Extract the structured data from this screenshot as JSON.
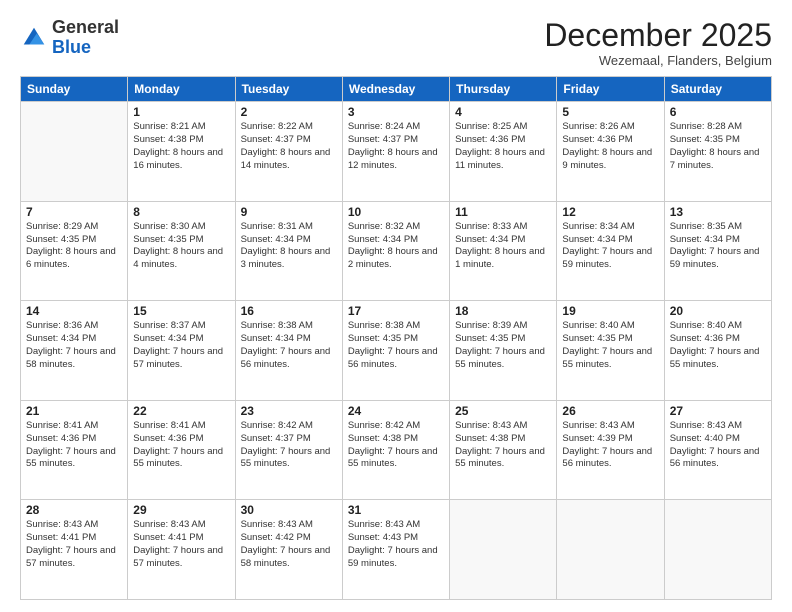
{
  "header": {
    "logo_general": "General",
    "logo_blue": "Blue",
    "month_title": "December 2025",
    "location": "Wezemaal, Flanders, Belgium"
  },
  "weekdays": [
    "Sunday",
    "Monday",
    "Tuesday",
    "Wednesday",
    "Thursday",
    "Friday",
    "Saturday"
  ],
  "weeks": [
    [
      {
        "day": "",
        "sunrise": "",
        "sunset": "",
        "daylight": ""
      },
      {
        "day": "1",
        "sunrise": "Sunrise: 8:21 AM",
        "sunset": "Sunset: 4:38 PM",
        "daylight": "Daylight: 8 hours and 16 minutes."
      },
      {
        "day": "2",
        "sunrise": "Sunrise: 8:22 AM",
        "sunset": "Sunset: 4:37 PM",
        "daylight": "Daylight: 8 hours and 14 minutes."
      },
      {
        "day": "3",
        "sunrise": "Sunrise: 8:24 AM",
        "sunset": "Sunset: 4:37 PM",
        "daylight": "Daylight: 8 hours and 12 minutes."
      },
      {
        "day": "4",
        "sunrise": "Sunrise: 8:25 AM",
        "sunset": "Sunset: 4:36 PM",
        "daylight": "Daylight: 8 hours and 11 minutes."
      },
      {
        "day": "5",
        "sunrise": "Sunrise: 8:26 AM",
        "sunset": "Sunset: 4:36 PM",
        "daylight": "Daylight: 8 hours and 9 minutes."
      },
      {
        "day": "6",
        "sunrise": "Sunrise: 8:28 AM",
        "sunset": "Sunset: 4:35 PM",
        "daylight": "Daylight: 8 hours and 7 minutes."
      }
    ],
    [
      {
        "day": "7",
        "sunrise": "Sunrise: 8:29 AM",
        "sunset": "Sunset: 4:35 PM",
        "daylight": "Daylight: 8 hours and 6 minutes."
      },
      {
        "day": "8",
        "sunrise": "Sunrise: 8:30 AM",
        "sunset": "Sunset: 4:35 PM",
        "daylight": "Daylight: 8 hours and 4 minutes."
      },
      {
        "day": "9",
        "sunrise": "Sunrise: 8:31 AM",
        "sunset": "Sunset: 4:34 PM",
        "daylight": "Daylight: 8 hours and 3 minutes."
      },
      {
        "day": "10",
        "sunrise": "Sunrise: 8:32 AM",
        "sunset": "Sunset: 4:34 PM",
        "daylight": "Daylight: 8 hours and 2 minutes."
      },
      {
        "day": "11",
        "sunrise": "Sunrise: 8:33 AM",
        "sunset": "Sunset: 4:34 PM",
        "daylight": "Daylight: 8 hours and 1 minute."
      },
      {
        "day": "12",
        "sunrise": "Sunrise: 8:34 AM",
        "sunset": "Sunset: 4:34 PM",
        "daylight": "Daylight: 7 hours and 59 minutes."
      },
      {
        "day": "13",
        "sunrise": "Sunrise: 8:35 AM",
        "sunset": "Sunset: 4:34 PM",
        "daylight": "Daylight: 7 hours and 59 minutes."
      }
    ],
    [
      {
        "day": "14",
        "sunrise": "Sunrise: 8:36 AM",
        "sunset": "Sunset: 4:34 PM",
        "daylight": "Daylight: 7 hours and 58 minutes."
      },
      {
        "day": "15",
        "sunrise": "Sunrise: 8:37 AM",
        "sunset": "Sunset: 4:34 PM",
        "daylight": "Daylight: 7 hours and 57 minutes."
      },
      {
        "day": "16",
        "sunrise": "Sunrise: 8:38 AM",
        "sunset": "Sunset: 4:34 PM",
        "daylight": "Daylight: 7 hours and 56 minutes."
      },
      {
        "day": "17",
        "sunrise": "Sunrise: 8:38 AM",
        "sunset": "Sunset: 4:35 PM",
        "daylight": "Daylight: 7 hours and 56 minutes."
      },
      {
        "day": "18",
        "sunrise": "Sunrise: 8:39 AM",
        "sunset": "Sunset: 4:35 PM",
        "daylight": "Daylight: 7 hours and 55 minutes."
      },
      {
        "day": "19",
        "sunrise": "Sunrise: 8:40 AM",
        "sunset": "Sunset: 4:35 PM",
        "daylight": "Daylight: 7 hours and 55 minutes."
      },
      {
        "day": "20",
        "sunrise": "Sunrise: 8:40 AM",
        "sunset": "Sunset: 4:36 PM",
        "daylight": "Daylight: 7 hours and 55 minutes."
      }
    ],
    [
      {
        "day": "21",
        "sunrise": "Sunrise: 8:41 AM",
        "sunset": "Sunset: 4:36 PM",
        "daylight": "Daylight: 7 hours and 55 minutes."
      },
      {
        "day": "22",
        "sunrise": "Sunrise: 8:41 AM",
        "sunset": "Sunset: 4:36 PM",
        "daylight": "Daylight: 7 hours and 55 minutes."
      },
      {
        "day": "23",
        "sunrise": "Sunrise: 8:42 AM",
        "sunset": "Sunset: 4:37 PM",
        "daylight": "Daylight: 7 hours and 55 minutes."
      },
      {
        "day": "24",
        "sunrise": "Sunrise: 8:42 AM",
        "sunset": "Sunset: 4:38 PM",
        "daylight": "Daylight: 7 hours and 55 minutes."
      },
      {
        "day": "25",
        "sunrise": "Sunrise: 8:43 AM",
        "sunset": "Sunset: 4:38 PM",
        "daylight": "Daylight: 7 hours and 55 minutes."
      },
      {
        "day": "26",
        "sunrise": "Sunrise: 8:43 AM",
        "sunset": "Sunset: 4:39 PM",
        "daylight": "Daylight: 7 hours and 56 minutes."
      },
      {
        "day": "27",
        "sunrise": "Sunrise: 8:43 AM",
        "sunset": "Sunset: 4:40 PM",
        "daylight": "Daylight: 7 hours and 56 minutes."
      }
    ],
    [
      {
        "day": "28",
        "sunrise": "Sunrise: 8:43 AM",
        "sunset": "Sunset: 4:41 PM",
        "daylight": "Daylight: 7 hours and 57 minutes."
      },
      {
        "day": "29",
        "sunrise": "Sunrise: 8:43 AM",
        "sunset": "Sunset: 4:41 PM",
        "daylight": "Daylight: 7 hours and 57 minutes."
      },
      {
        "day": "30",
        "sunrise": "Sunrise: 8:43 AM",
        "sunset": "Sunset: 4:42 PM",
        "daylight": "Daylight: 7 hours and 58 minutes."
      },
      {
        "day": "31",
        "sunrise": "Sunrise: 8:43 AM",
        "sunset": "Sunset: 4:43 PM",
        "daylight": "Daylight: 7 hours and 59 minutes."
      },
      {
        "day": "",
        "sunrise": "",
        "sunset": "",
        "daylight": ""
      },
      {
        "day": "",
        "sunrise": "",
        "sunset": "",
        "daylight": ""
      },
      {
        "day": "",
        "sunrise": "",
        "sunset": "",
        "daylight": ""
      }
    ]
  ]
}
